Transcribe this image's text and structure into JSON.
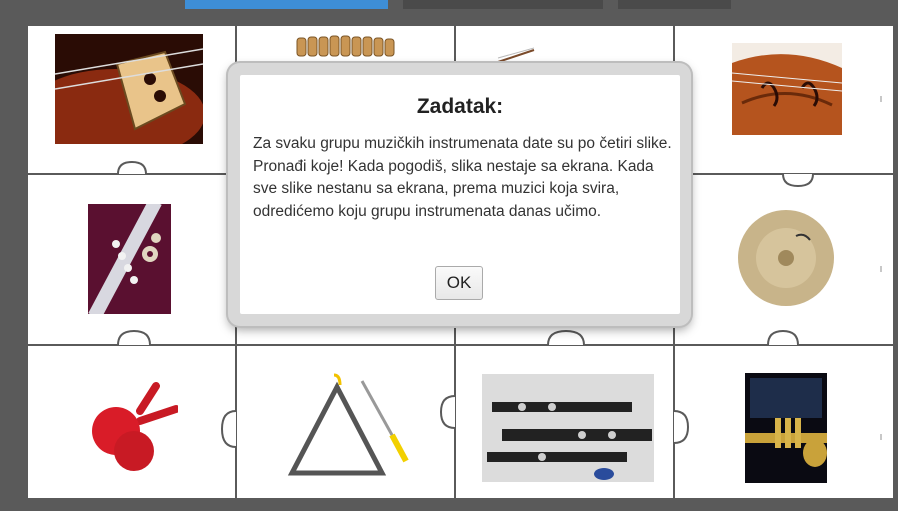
{
  "dialog": {
    "title": "Zadatak:",
    "body": "Za svaku grupu muzičkih instrumenata date su po četiri slike. Pronađi koje! Kada pogodiš, slika nestaje sa ekrana. Kada sve slike nestanu sa ekrana, prema muzici koja svira, odredićemo koju grupu instrumenata danas učimo.",
    "ok_label": "OK"
  },
  "pieces": [
    {
      "row": 1,
      "col": 1,
      "icon": "violin-bridge-photo-icon"
    },
    {
      "row": 1,
      "col": 2,
      "icon": "pan-flute-photo-icon"
    },
    {
      "row": 1,
      "col": 3,
      "icon": "bow-photo-icon"
    },
    {
      "row": 1,
      "col": 4,
      "icon": "violin-photo-icon"
    },
    {
      "row": 2,
      "col": 1,
      "icon": "flute-photo-icon"
    },
    {
      "row": 2,
      "col": 4,
      "icon": "cymbal-photo-icon"
    },
    {
      "row": 3,
      "col": 1,
      "icon": "maracas-photo-icon"
    },
    {
      "row": 3,
      "col": 2,
      "icon": "triangle-photo-icon"
    },
    {
      "row": 3,
      "col": 3,
      "icon": "clarinet-photo-icon"
    },
    {
      "row": 3,
      "col": 4,
      "icon": "trumpet-photo-icon"
    }
  ],
  "colors": {
    "background": "#5a5a5a",
    "active_tab": "#3e8ed6",
    "board": "#ffffff"
  }
}
